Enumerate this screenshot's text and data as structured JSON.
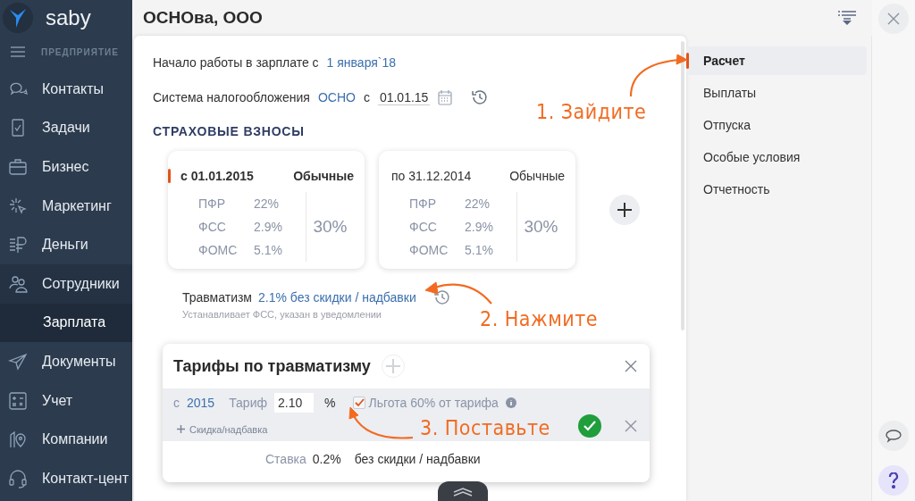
{
  "app": {
    "logo_text": "saby",
    "section": "ПРЕДПРИЯТИЕ"
  },
  "sidebar": {
    "items": [
      {
        "label": "Контакты",
        "selected": false
      },
      {
        "label": "Задачи",
        "selected": false
      },
      {
        "label": "Бизнес",
        "selected": false
      },
      {
        "label": "Маркетинг",
        "selected": false
      },
      {
        "label": "Деньги",
        "selected": false
      },
      {
        "label": "Сотрудники",
        "selected": false,
        "children": [
          {
            "label": "Зарплата",
            "selected": true
          }
        ]
      },
      {
        "label": "Документы",
        "selected": false
      },
      {
        "label": "Учет",
        "selected": false
      },
      {
        "label": "Компании",
        "selected": false
      },
      {
        "label": "Контакт-цент",
        "selected": false
      }
    ]
  },
  "header": {
    "title": "ОСНОва, ООО"
  },
  "content": {
    "start": {
      "label": "Начало работы в зарплате с",
      "value": "1 января`18"
    },
    "tax": {
      "label": "Система налогообложения",
      "value": "ОСНО",
      "from_label": "с",
      "date": "01.01.15"
    },
    "section_title": "СТРАХОВЫЕ ВЗНОСЫ",
    "cards": [
      {
        "period": "с 01.01.2015",
        "type": "Обычные",
        "selected": true,
        "rates": [
          {
            "name": "ПФР",
            "value": "22%"
          },
          {
            "name": "ФСС",
            "value": "2.9%"
          },
          {
            "name": "ФОМС",
            "value": "5.1%"
          }
        ],
        "total": "30%"
      },
      {
        "period": "по 31.12.2014",
        "type": "Обычные",
        "selected": false,
        "rates": [
          {
            "name": "ПФР",
            "value": "22%"
          },
          {
            "name": "ФСС",
            "value": "2.9%"
          },
          {
            "name": "ФОМС",
            "value": "5.1%"
          }
        ],
        "total": "30%"
      }
    ],
    "injury": {
      "label": "Травматизм",
      "value": "2.1% без скидки / надбавки",
      "note": "Устанавливает ФСС, указан в уведомлении"
    }
  },
  "nav": {
    "items": [
      {
        "label": "Расчет",
        "selected": true
      },
      {
        "label": "Выплаты",
        "selected": false
      },
      {
        "label": "Отпуска",
        "selected": false
      },
      {
        "label": "Особые условия",
        "selected": false
      },
      {
        "label": "Отчетность",
        "selected": false
      }
    ]
  },
  "popup": {
    "title": "Тарифы по травматизму",
    "from_label": "с",
    "year": "2015",
    "rate_label": "Тариф",
    "rate_value": "2.10",
    "unit": "%",
    "benefit": {
      "label": "Льгота 60% от тарифа",
      "checked": true
    },
    "add_link": "Скидка/надбавка",
    "summary_label": "Ставка",
    "summary_value": "0.2%",
    "summary_note": "без скидки / надбавки"
  },
  "annotations": [
    {
      "text": "1. Зайдите"
    },
    {
      "text": "2. Нажмите"
    },
    {
      "text": "3. Поставьте"
    }
  ]
}
